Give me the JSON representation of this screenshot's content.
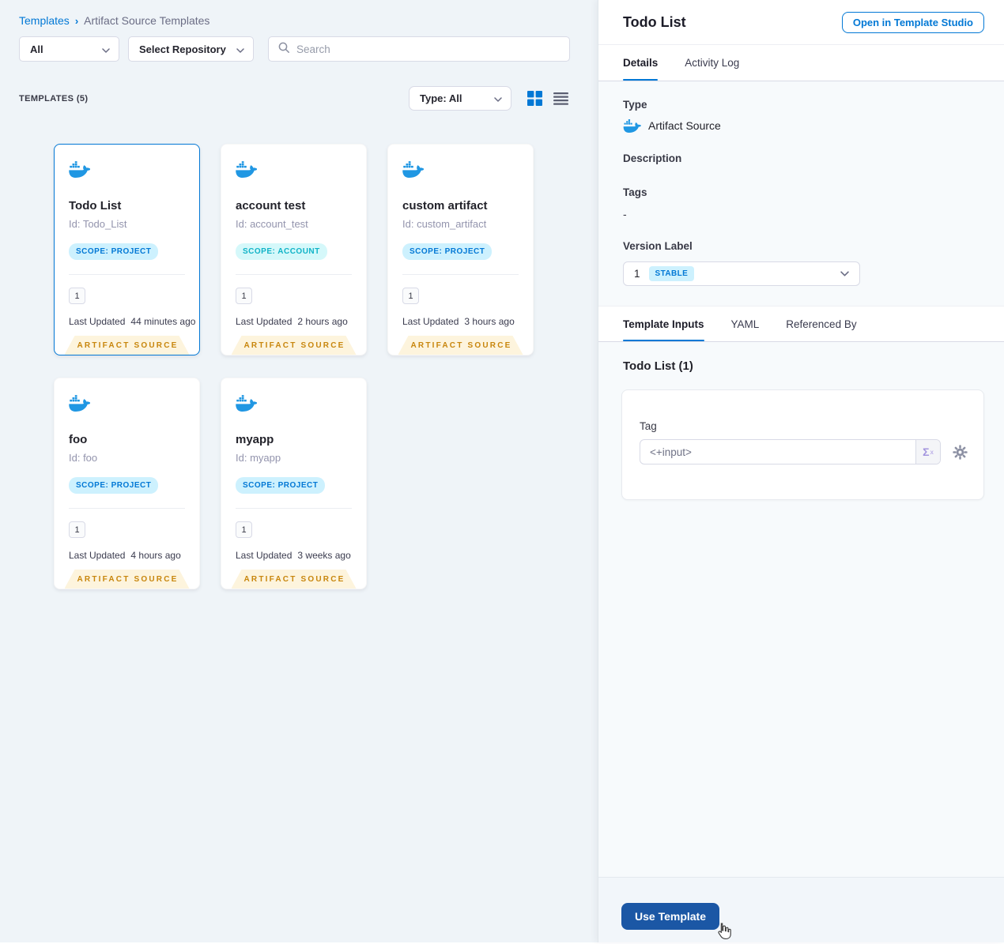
{
  "colors": {
    "accent": "#0278d5",
    "docker_blue": "#2097e3",
    "scope_project_bg": "#cdf1fe",
    "scope_project_text": "#0278d5",
    "scope_account_bg": "#d5f8fa",
    "scope_account_text": "#10b3c7",
    "ribbon_bg": "#fdf4dd",
    "ribbon_text": "#c8860d",
    "use_button_bg": "#1b57a5"
  },
  "breadcrumb": {
    "link": "Templates",
    "separator": "›",
    "current": "Artifact Source Templates"
  },
  "filters": {
    "scope": "All",
    "repository": "Select Repository",
    "search_placeholder": "Search"
  },
  "list_header": {
    "count": "TEMPLATES (5)",
    "type_filter": "Type: All"
  },
  "card_common": {
    "updated_label": "Last Updated",
    "ribbon": "ARTIFACT SOURCE"
  },
  "cards": [
    {
      "title": "Todo List",
      "id": "Id: Todo_List",
      "scope": "SCOPE: PROJECT",
      "version": "1",
      "updated": "44 minutes ago"
    },
    {
      "title": "account test",
      "id": "Id: account_test",
      "scope": "SCOPE: ACCOUNT",
      "version": "1",
      "updated": "2 hours ago"
    },
    {
      "title": "custom artifact",
      "id": "Id: custom_artifact",
      "scope": "SCOPE: PROJECT",
      "version": "1",
      "updated": "3 hours ago"
    },
    {
      "title": "foo",
      "id": "Id: foo",
      "scope": "SCOPE: PROJECT",
      "version": "1",
      "updated": "4 hours ago"
    },
    {
      "title": "myapp",
      "id": "Id: myapp",
      "scope": "SCOPE: PROJECT",
      "version": "1",
      "updated": "3 weeks ago"
    }
  ],
  "panel": {
    "title": "Todo List",
    "open_studio": "Open in Template Studio",
    "tabs": {
      "details": "Details",
      "activity_log": "Activity Log"
    },
    "type_label": "Type",
    "type_value": "Artifact Source",
    "description_label": "Description",
    "tags_label": "Tags",
    "tags_value": "-",
    "version_label": "Version Label",
    "version_value": "1",
    "version_badge": "STABLE",
    "inputs_tabs": {
      "template_inputs": "Template Inputs",
      "yaml": "YAML",
      "referenced_by": "Referenced By"
    },
    "inputs_title": "Todo List (1)",
    "tag_label": "Tag",
    "tag_value": "<+input>",
    "expression_symbol": "Σ",
    "expression_sup": "x",
    "use_template": "Use Template"
  }
}
